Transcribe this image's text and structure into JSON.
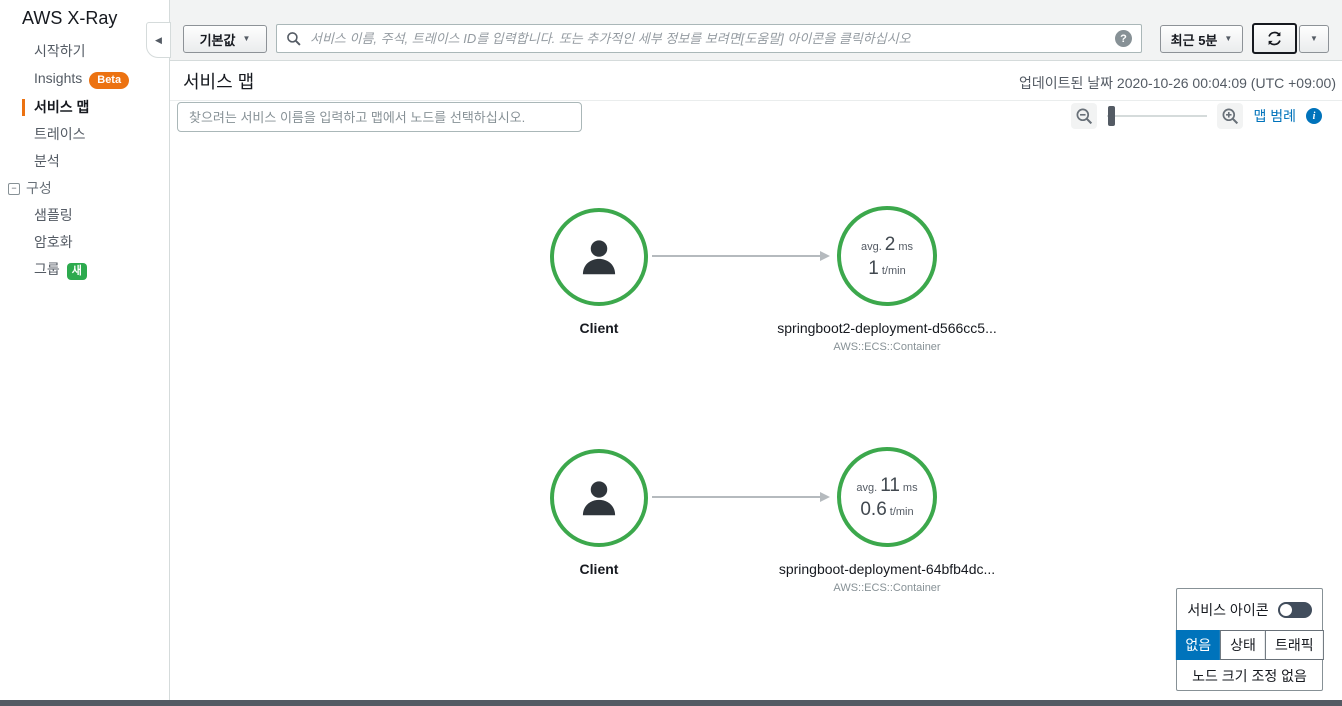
{
  "sidebar": {
    "title": "AWS X-Ray",
    "items": [
      {
        "label": "시작하기"
      },
      {
        "label": "Insights",
        "badge": "Beta"
      },
      {
        "label": "서비스 맵",
        "active": true
      },
      {
        "label": "트레이스"
      },
      {
        "label": "분석"
      },
      {
        "label": "구성",
        "section": true
      },
      {
        "label": "샘플링"
      },
      {
        "label": "암호화"
      },
      {
        "label": "그룹",
        "badge": "새"
      }
    ]
  },
  "topbar": {
    "filter_button": "기본값",
    "search_placeholder": "서비스 이름, 주석, 트레이스 ID를 입력합니다. 또는 추가적인 세부 정보를 보려면[도움말] 아이콘을 클릭하십시오",
    "time_range_button": "최근 5분"
  },
  "header": {
    "title": "서비스 맵",
    "updated": "업데이트된 날짜 2020-10-26 00:04:09 (UTC +09:00)"
  },
  "map_toolbar": {
    "search_placeholder": "찾으려는 서비스 이름을 입력하고 맵에서 노드를 선택하십시오.",
    "legend_label": "맵 범례"
  },
  "graph": {
    "rows": [
      {
        "client_label": "Client",
        "service": {
          "avg_prefix": "avg.",
          "avg_value": "2",
          "avg_unit": "ms",
          "rate_value": "1",
          "rate_unit": "t/min",
          "name": "springboot2-deployment-d566cc5...",
          "type": "AWS::ECS::Container"
        }
      },
      {
        "client_label": "Client",
        "service": {
          "avg_prefix": "avg.",
          "avg_value": "11",
          "avg_unit": "ms",
          "rate_value": "0.6",
          "rate_unit": "t/min",
          "name": "springboot-deployment-64bfb4dc...",
          "type": "AWS::ECS::Container"
        }
      }
    ]
  },
  "legend_panel": {
    "toggle_label": "서비스 아이콘",
    "tabs": [
      {
        "label": "없음",
        "active": true
      },
      {
        "label": "상태",
        "active": false
      },
      {
        "label": "트래픽",
        "active": false
      }
    ],
    "footer": "노드 크기 조정 없음"
  },
  "icons": {
    "search": "magnifier",
    "help": "question-mark-circle",
    "refresh": "circular-arrows",
    "zoom_out": "magnifier-minus",
    "zoom_in": "magnifier-plus",
    "info": "i-circle",
    "client": "person-silhouette",
    "config_section": "minus-square",
    "caret_down": "▼",
    "collapse_left": "◀",
    "minus_glyph": "−",
    "question_glyph": "?",
    "info_glyph": "i"
  },
  "colors": {
    "accent_orange": "#ec7211",
    "badge_green": "#2daa4e",
    "node_green": "#3ca84c",
    "link_blue": "#0073bb",
    "selected_tab_blue": "#0073bb",
    "topbar_gray": "#f2f3f3",
    "bottom_bar_gray": "#545b64"
  }
}
